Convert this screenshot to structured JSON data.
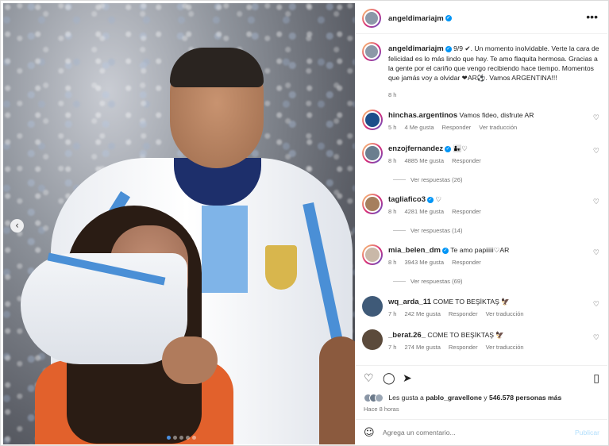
{
  "post": {
    "username": "angeldimariajm",
    "caption_user": "angeldimariajm",
    "caption_text": "9/9 ✔. Un momento inolvidable. Verte la cara de felicidad es lo más lindo que hay. Te amo flaquita hermosa. Gracias a la gente por el cariño que vengo recibiendo hace tiempo. Momentos que jamás voy a olvidar ❤AR⚽. Vamos ARGENTINA!!!",
    "caption_time": "8 h"
  },
  "comments": [
    {
      "user": "hinchas.argentinos",
      "text": "Vamos fideo, disfrute AR",
      "time": "5 h",
      "likes": "4 Me gusta",
      "reply": "Responder",
      "translate": "Ver traducción",
      "verified": false
    },
    {
      "user": "enzojfernandez",
      "text": "👨‍👧♡",
      "time": "8 h",
      "likes": "4885 Me gusta",
      "reply": "Responder",
      "translate": "",
      "verified": true,
      "view_replies": "Ver respuestas (26)"
    },
    {
      "user": "tagliafico3",
      "text": "♡",
      "time": "8 h",
      "likes": "4281 Me gusta",
      "reply": "Responder",
      "translate": "",
      "verified": true,
      "view_replies": "Ver respuestas (14)"
    },
    {
      "user": "mia_belen_dm",
      "text": "Te amo papiiiii♡AR",
      "time": "8 h",
      "likes": "3943 Me gusta",
      "reply": "Responder",
      "translate": "",
      "verified": true,
      "view_replies": "Ver respuestas (69)"
    },
    {
      "user": "wq_arda_11",
      "text": "COME TO BEŞİKTAŞ 🦅",
      "time": "7 h",
      "likes": "242 Me gusta",
      "reply": "Responder",
      "translate": "Ver traducción",
      "verified": false
    },
    {
      "user": "_berat.26_",
      "text": "COME TO BEŞİKTAŞ 🦅",
      "time": "7 h",
      "likes": "274 Me gusta",
      "reply": "Responder",
      "translate": "Ver traducción",
      "verified": false
    }
  ],
  "likes": {
    "prefix": "Les gusta a ",
    "user": "pablo_gravellone",
    "middle": " y ",
    "count": "546.578 personas más"
  },
  "time_ago": "Hace 8 horas",
  "add_comment": {
    "placeholder": "Agrega un comentario...",
    "publish": "Publicar"
  },
  "icons": {
    "more": "more-horizontal-icon",
    "like": "heart-icon",
    "comment": "comment-icon",
    "share": "send-icon",
    "save": "bookmark-icon",
    "emoji": "emoji-icon",
    "prev": "chevron-left-icon"
  },
  "carousel": {
    "total": 9,
    "current": 1
  },
  "colors": {
    "verified": "#0095f6",
    "link": "#0095f6",
    "publish_disabled": "#b2dffc"
  }
}
